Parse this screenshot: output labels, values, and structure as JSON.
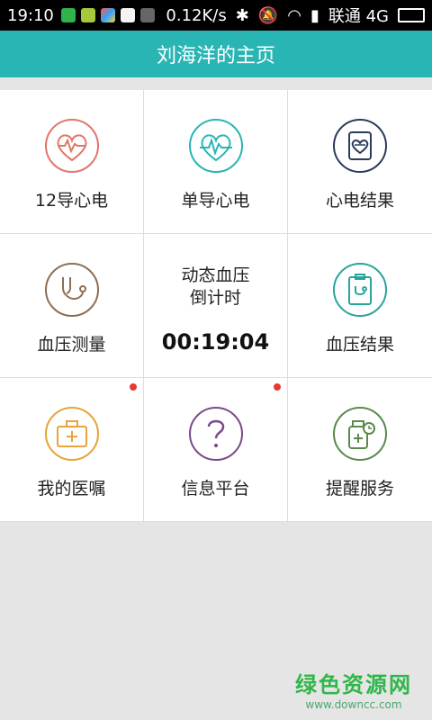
{
  "status_bar": {
    "time": "19:10",
    "speed": "0.12K/s",
    "carrier": "联通 4G"
  },
  "header": {
    "title": "刘海洋的主页"
  },
  "grid": {
    "items": [
      {
        "label": "12导心电",
        "icon": "heart-ecg-icon",
        "color": "#e0776a"
      },
      {
        "label": "单导心电",
        "icon": "heart-pulse-icon",
        "color": "#2ab5b5"
      },
      {
        "label": "心电结果",
        "icon": "ecg-report-icon",
        "color": "#2d3b5c"
      },
      {
        "label": "血压测量",
        "icon": "stethoscope-icon",
        "color": "#8e6e52"
      },
      {
        "title_line1": "动态血压",
        "title_line2": "倒计时",
        "time": "00:19:04"
      },
      {
        "label": "血压结果",
        "icon": "clipboard-stethoscope-icon",
        "color": "#2aa59a"
      },
      {
        "label": "我的医嘱",
        "icon": "medical-kit-icon",
        "color": "#e7a43a"
      },
      {
        "label": "信息平台",
        "icon": "question-icon",
        "color": "#7a4a8a"
      },
      {
        "label": "提醒服务",
        "icon": "medicine-bottle-clock-icon",
        "color": "#5a8a4a"
      }
    ]
  },
  "watermark": {
    "main": "绿色资源网",
    "url": "www.downcc.com"
  }
}
